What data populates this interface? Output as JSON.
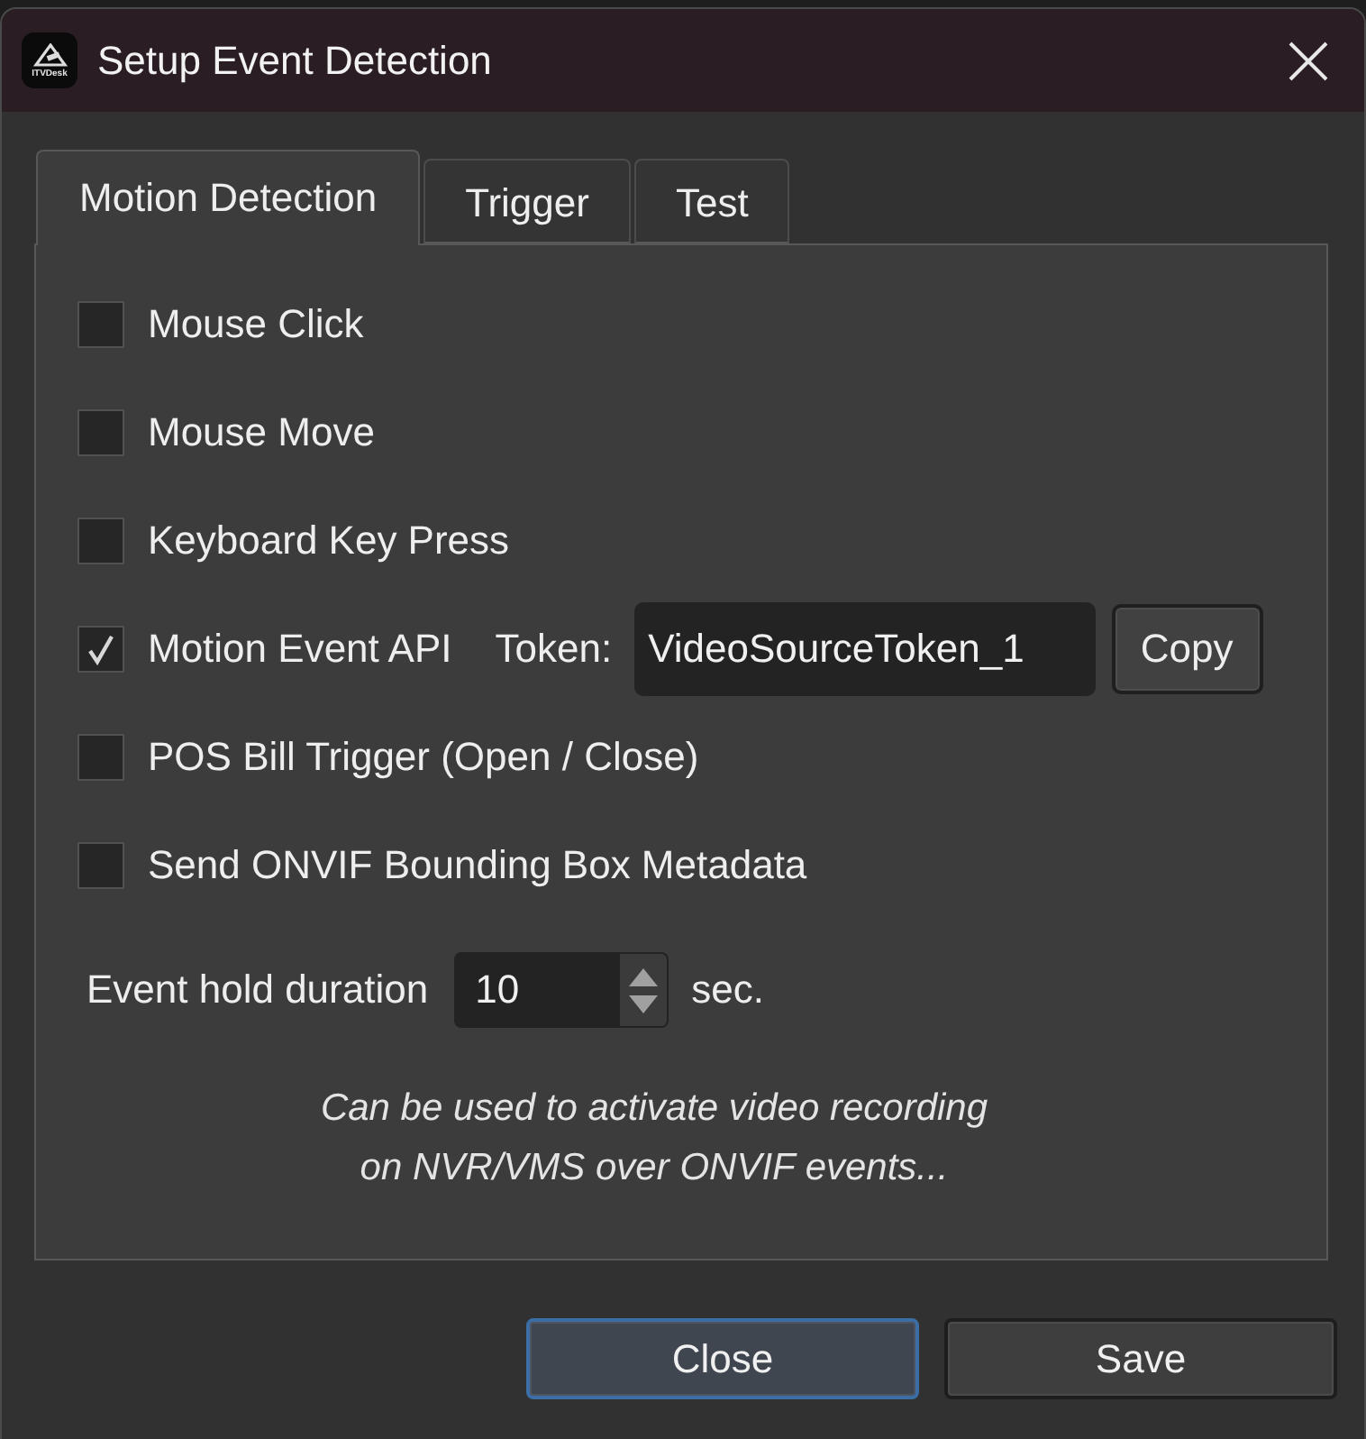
{
  "window": {
    "title": "Setup Event Detection",
    "logo_text": "ITVDesk"
  },
  "tabs": [
    {
      "label": "Motion Detection",
      "selected": true
    },
    {
      "label": "Trigger",
      "selected": false
    },
    {
      "label": "Test",
      "selected": false
    }
  ],
  "options": [
    {
      "label": "Mouse Click",
      "checked": false
    },
    {
      "label": "Mouse Move",
      "checked": false
    },
    {
      "label": "Keyboard Key Press",
      "checked": false
    },
    {
      "label": "Motion Event API",
      "checked": true,
      "token": {
        "label": "Token:",
        "value": "VideoSourceToken_1",
        "button": "Copy"
      }
    },
    {
      "label": "POS Bill Trigger (Open / Close)",
      "checked": false
    },
    {
      "label": "Send ONVIF Bounding Box Metadata",
      "checked": false
    }
  ],
  "hold_duration": {
    "label": "Event hold duration",
    "value": "10",
    "unit": "sec."
  },
  "note": "Can be used to activate video recording\non NVR/VMS over ONVIF events...",
  "buttons": [
    {
      "label": "Close",
      "default": true
    },
    {
      "label": "Save",
      "default": false
    }
  ]
}
